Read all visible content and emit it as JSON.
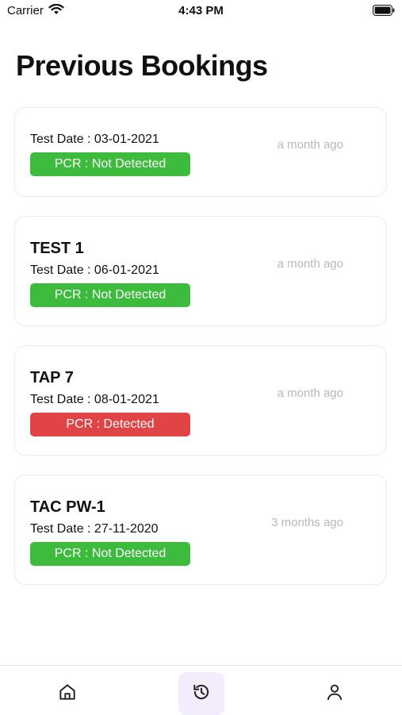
{
  "status_bar": {
    "carrier": "Carrier",
    "time": "4:43 PM"
  },
  "page": {
    "title": "Previous Bookings"
  },
  "bookings": [
    {
      "title": "",
      "test_date": "Test Date : 03-01-2021",
      "result": "PCR : Not Detected",
      "result_status": "not-detected",
      "time_ago": "a month ago"
    },
    {
      "title": "TEST 1",
      "test_date": "Test Date : 06-01-2021",
      "result": "PCR : Not Detected",
      "result_status": "not-detected",
      "time_ago": "a month ago"
    },
    {
      "title": "TAP 7",
      "test_date": "Test Date : 08-01-2021",
      "result": "PCR : Detected",
      "result_status": "detected",
      "time_ago": "a month ago"
    },
    {
      "title": "TAC PW-1",
      "test_date": "Test Date : 27-11-2020",
      "result": "PCR : Not Detected",
      "result_status": "not-detected",
      "time_ago": "3 months ago"
    }
  ],
  "tab_bar": {
    "tabs": [
      {
        "icon": "home-icon",
        "active": false
      },
      {
        "icon": "history-icon",
        "active": true
      },
      {
        "icon": "user-icon",
        "active": false
      }
    ]
  },
  "colors": {
    "not_detected": "#3cbb3c",
    "detected": "#e14444",
    "active_tab_bg": "#f3ecfc",
    "muted_text": "#b9b9b9"
  }
}
